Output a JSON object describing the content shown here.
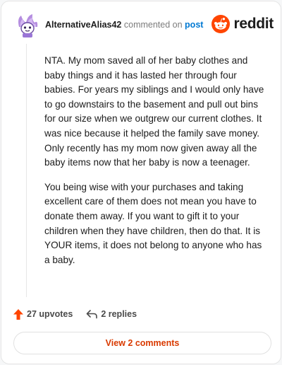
{
  "comment": {
    "username": "AlternativeAlias42",
    "action_text": "commented on",
    "target_text": "post",
    "paragraphs": [
      "NTA. My mom saved all of her baby clothes and baby things and it has lasted her through four babies. For years my siblings and I would only have to go downstairs to the basement and pull out bins for our size when we outgrew our current clothes. It was nice because it helped the family save money. Only recently has my mom now given away all the baby items now that her baby is now a teenager.",
      "You being wise with your purchases and taking excellent care of them does not mean you have to donate them away. If you want to gift it to your children when they have children, then do that. It is YOUR items, it does not belong to anyone who has a baby."
    ]
  },
  "brand": {
    "wordmark": "reddit",
    "icon": "reddit-snoo-icon",
    "color": "#ff4500"
  },
  "actions": {
    "upvotes_label": "27 upvotes",
    "upvote_icon": "upvote-arrow-icon",
    "replies_label": "2 replies",
    "reply_icon": "reply-arrow-icon"
  },
  "view_comments_label": "View 2 comments",
  "colors": {
    "accent_orange": "#ff4500",
    "link_blue": "#0079d3",
    "view_button_text": "#d93a00"
  }
}
